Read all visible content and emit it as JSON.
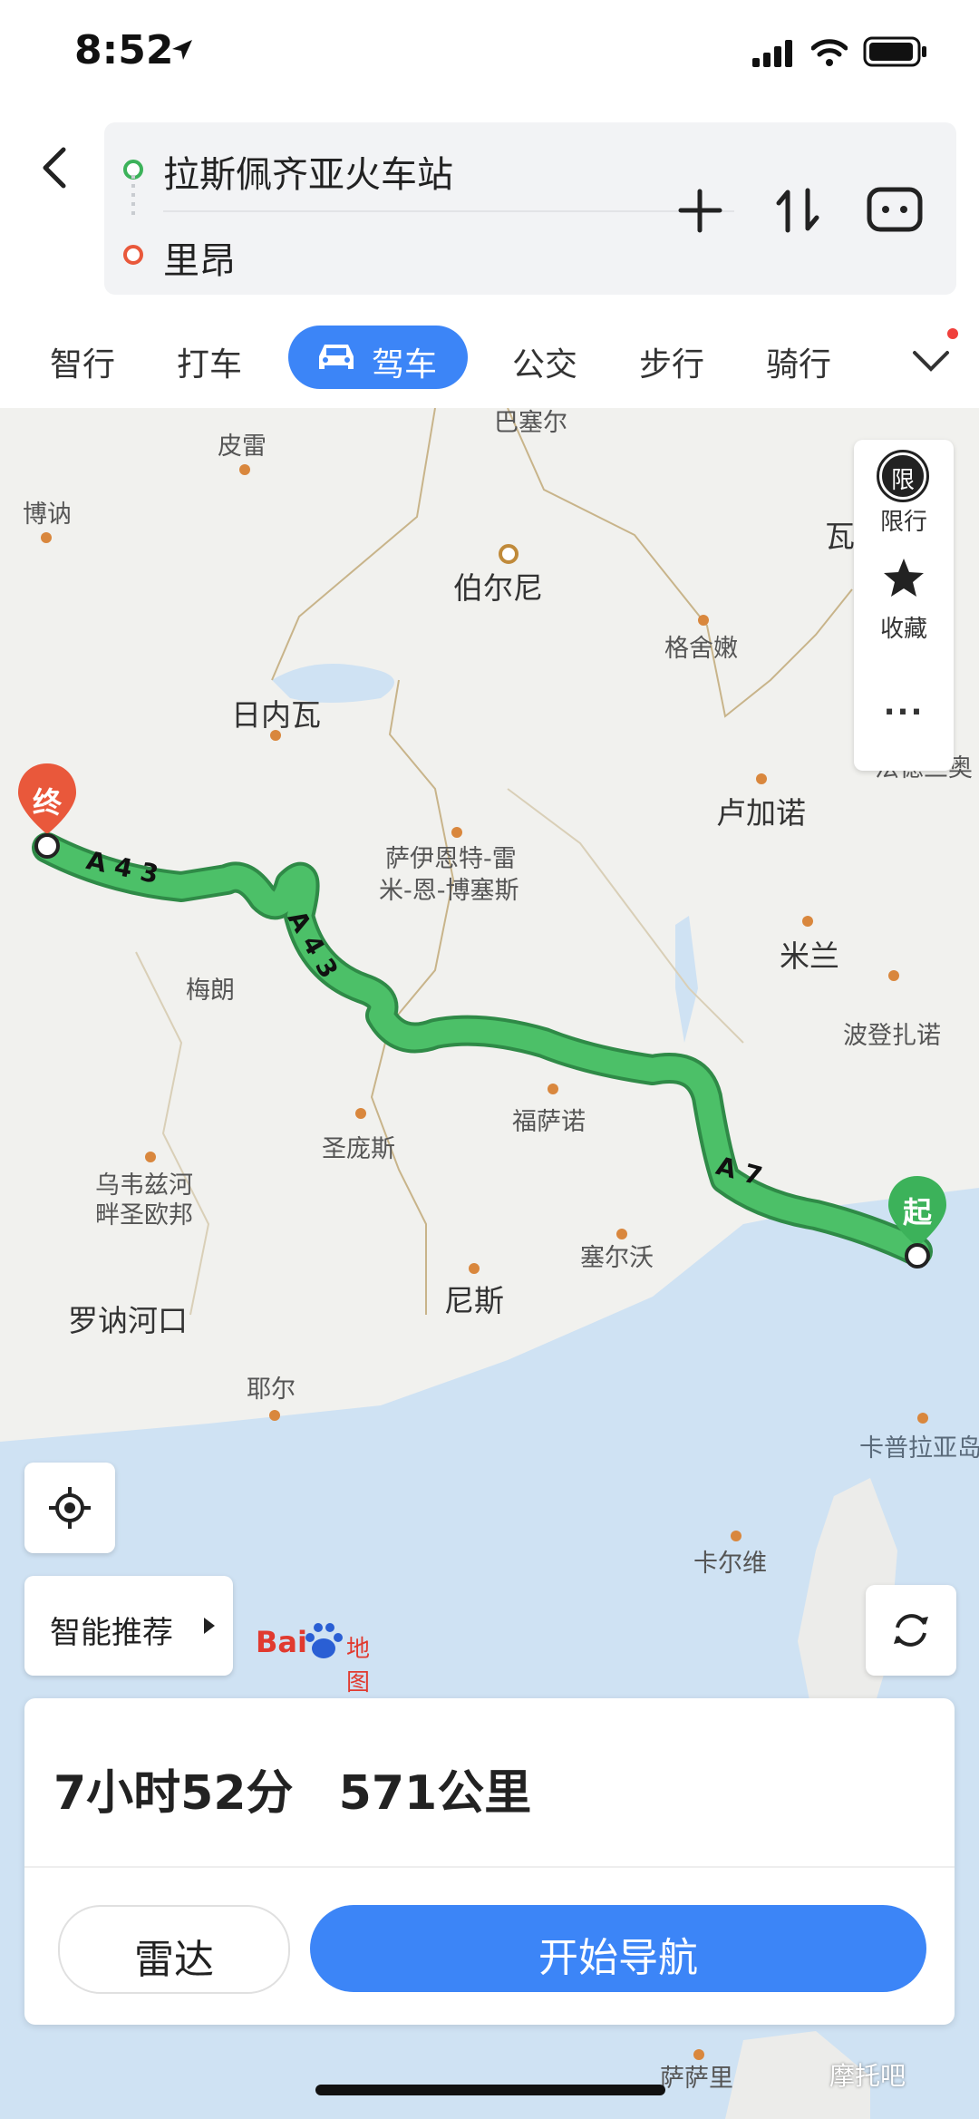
{
  "status_bar": {
    "time": "8:52"
  },
  "route": {
    "origin": "拉斯佩齐亚火车站",
    "destination": "里昂"
  },
  "tabs": [
    {
      "label": "智行"
    },
    {
      "label": "打车"
    },
    {
      "label": "驾车",
      "active": true
    },
    {
      "label": "公交"
    },
    {
      "label": "步行"
    },
    {
      "label": "骑行"
    }
  ],
  "map": {
    "places": [
      {
        "name": "皮雷"
      },
      {
        "name": "博讷"
      },
      {
        "name": "伯尔尼"
      },
      {
        "name": "瓦"
      },
      {
        "name": "格舍嫩"
      },
      {
        "name": "日内瓦"
      },
      {
        "name": "卢加诺"
      },
      {
        "name": "萨伊恩特-雷"
      },
      {
        "name": "米-恩-博塞斯"
      },
      {
        "name": "米兰"
      },
      {
        "name": "梅朗"
      },
      {
        "name": "波登扎诺"
      },
      {
        "name": "福萨诺"
      },
      {
        "name": "圣庞斯"
      },
      {
        "name": "乌韦兹河"
      },
      {
        "name": "畔圣欧邦"
      },
      {
        "name": "塞尔沃"
      },
      {
        "name": "尼斯"
      },
      {
        "name": "罗讷河口"
      },
      {
        "name": "耶尔"
      },
      {
        "name": "卡普拉亚岛"
      },
      {
        "name": "卡尔维"
      },
      {
        "name": "萨萨里"
      },
      {
        "name": "法德兰奥"
      },
      {
        "name": "巴塞尔"
      }
    ],
    "road_labels": {
      "a43": "A 4 3",
      "a7": "A 7"
    },
    "start_marker": "起",
    "end_marker": "终",
    "logo": {
      "brand": "Bai",
      "product": "地图"
    }
  },
  "side_panel": {
    "restrict_icon": "限",
    "restrict_label": "限行",
    "favorite_label": "收藏",
    "more": "..."
  },
  "smart_button": {
    "label": "智能推荐"
  },
  "summary": {
    "duration": "7小时52分",
    "distance": "571公里"
  },
  "buttons": {
    "radar": "雷达",
    "navigate": "开始导航"
  },
  "watermark": "摩托吧",
  "colors": {
    "accent": "#3c85f7",
    "route": "#3cb25a",
    "start": "#3cb25a",
    "end": "#e9583b"
  }
}
